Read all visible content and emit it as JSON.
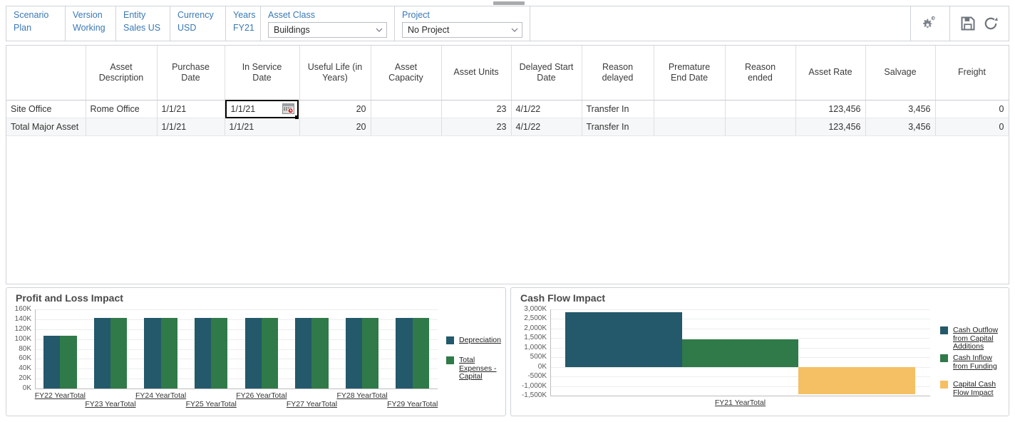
{
  "pov": {
    "cells": [
      {
        "label": "Scenario",
        "value": "Plan",
        "name": "pov-scenario"
      },
      {
        "label": "Version",
        "value": "Working",
        "name": "pov-version"
      },
      {
        "label": "Entity",
        "value": "Sales US",
        "name": "pov-entity"
      },
      {
        "label": "Currency",
        "value": "USD",
        "name": "pov-currency"
      },
      {
        "label": "Years",
        "value": "FY21",
        "name": "pov-years"
      }
    ],
    "asset_class": {
      "label": "Asset Class",
      "value": "Buildings"
    },
    "project": {
      "label": "Project",
      "value": "No Project"
    },
    "icons": {
      "settings": "gear-icon",
      "save": "save-icon",
      "refresh": "refresh-icon"
    }
  },
  "grid": {
    "columns": [
      "",
      "Asset\nDescription",
      "Purchase\nDate",
      "In Service\nDate",
      "Useful Life (in\nYears)",
      "Asset\nCapacity",
      "Asset Units",
      "Delayed Start\nDate",
      "Reason\ndelayed",
      "Premature\nEnd Date",
      "Reason\nended",
      "Asset Rate",
      "Salvage",
      "Freight"
    ],
    "rows": [
      {
        "row_header": "Site Office",
        "asset_description": "Rome Office",
        "purchase_date": "1/1/21",
        "in_service_date": "1/1/21",
        "useful_life_years": "20",
        "asset_capacity": "",
        "asset_units": "23",
        "delayed_start_date": "4/1/22",
        "reason_delayed": "Transfer In",
        "premature_end_date": "",
        "reason_ended": "",
        "asset_rate": "123,456",
        "salvage": "3,456",
        "freight": "0"
      },
      {
        "row_header": "Total Major Asset",
        "asset_description": "",
        "purchase_date": "1/1/21",
        "in_service_date": "1/1/21",
        "useful_life_years": "20",
        "asset_capacity": "",
        "asset_units": "23",
        "delayed_start_date": "4/1/22",
        "reason_delayed": "Transfer In",
        "premature_end_date": "",
        "reason_ended": "",
        "asset_rate": "123,456",
        "salvage": "3,456",
        "freight": "0"
      }
    ],
    "selected_cell": {
      "value": "1/1/21",
      "icon": "date-picker-icon",
      "row": 0,
      "column": "In Service Date"
    }
  },
  "chart_data": [
    {
      "id": "profit_loss",
      "type": "bar",
      "title": "Profit and Loss Impact",
      "xlabel": "",
      "ylabel": "",
      "ylim": [
        0,
        160000
      ],
      "ytick_labels": [
        "0K",
        "20K",
        "40K",
        "60K",
        "80K",
        "100K",
        "120K",
        "140K",
        "160K"
      ],
      "ytick_values": [
        0,
        20000,
        40000,
        60000,
        80000,
        100000,
        120000,
        140000,
        160000
      ],
      "grid": true,
      "legend_position": "right",
      "categories": [
        "FY22 YearTotal",
        "FY23 YearTotal",
        "FY24 YearTotal",
        "FY25 YearTotal",
        "FY26 YearTotal",
        "FY27 YearTotal",
        "FY28 YearTotal",
        "FY29 YearTotal"
      ],
      "series": [
        {
          "name": "Depreciation",
          "color": "#23596a",
          "values": [
            106000,
            142000,
            142000,
            142000,
            142000,
            142000,
            142000,
            142000
          ]
        },
        {
          "name": "Total Expenses - Capital",
          "color": "#2f7a48",
          "values": [
            106000,
            142000,
            142000,
            142000,
            142000,
            142000,
            142000,
            142000
          ]
        }
      ]
    },
    {
      "id": "cash_flow",
      "type": "bar",
      "title": "Cash Flow Impact",
      "xlabel": "",
      "ylabel": "",
      "ylim": [
        -1500000,
        3000000
      ],
      "ytick_labels": [
        "3,000K",
        "2,500K",
        "2,000K",
        "1,500K",
        "1,000K",
        "500K",
        "0K",
        "-500K",
        "-1,000K",
        "-1,500K"
      ],
      "ytick_values": [
        3000000,
        2500000,
        2000000,
        1500000,
        1000000,
        500000,
        0,
        -500000,
        -1000000,
        -1500000
      ],
      "grid": true,
      "legend_position": "right",
      "categories": [
        "FY21 YearTotal"
      ],
      "series": [
        {
          "name": "Cash Outflow from Capital Additions",
          "color": "#23596a",
          "values": [
            2850000
          ]
        },
        {
          "name": "Cash Inflow from Funding",
          "color": "#2f7a48",
          "values": [
            1430000
          ]
        },
        {
          "name": "Capital Cash Flow Impact",
          "color": "#f5bf63",
          "values": [
            -1420000
          ]
        }
      ]
    }
  ]
}
